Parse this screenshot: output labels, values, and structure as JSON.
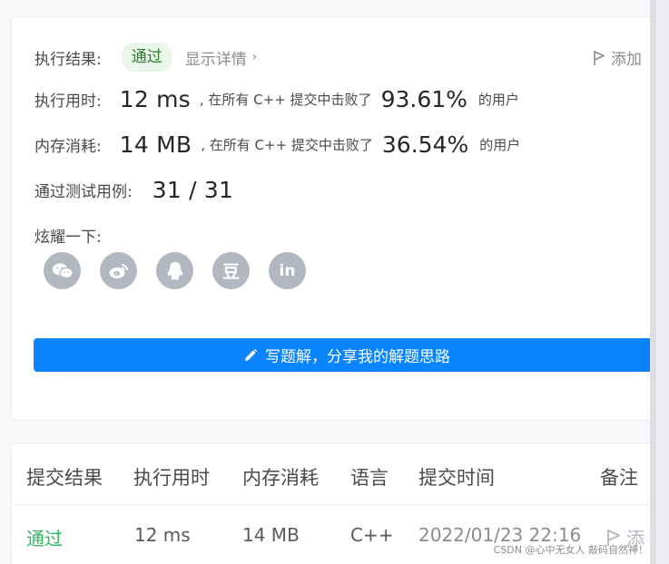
{
  "result": {
    "label": "执行结果:",
    "status": "通过",
    "details": "显示详情",
    "add_note": "添加"
  },
  "runtime": {
    "label": "执行用时:",
    "value": "12 ms",
    "middle": ", 在所有 C++ 提交中击败了",
    "percent": "93.61%",
    "suffix": "的用户"
  },
  "memory": {
    "label": "内存消耗:",
    "value": "14 MB",
    "middle": ", 在所有 C++ 提交中击败了",
    "percent": "36.54%",
    "suffix": "的用户"
  },
  "tests": {
    "label": "通过测试用例:",
    "value": "31 / 31"
  },
  "share": {
    "label": "炫耀一下:",
    "icons": [
      "wechat-icon",
      "weibo-icon",
      "qq-icon",
      "douban-icon",
      "linkedin-icon"
    ],
    "douban_glyph": "豆",
    "linkedin_glyph": "in"
  },
  "write_button": {
    "label": "写题解，分享我的解题思路",
    "color": "#0a84ff"
  },
  "table": {
    "headers": [
      "提交结果",
      "执行用时",
      "内存消耗",
      "语言",
      "提交时间",
      "备注"
    ],
    "rows": [
      {
        "status": "通过",
        "runtime": "12 ms",
        "memory": "14 MB",
        "language": "C++",
        "time": "2022/01/23 22:16",
        "note": "添"
      }
    ]
  },
  "watermark": "CSDN @心中无女人 敲码自然神！！",
  "colors": {
    "accent": "#0a84ff",
    "pass": "#2db55d",
    "badge_bg": "#eaf6ea"
  }
}
